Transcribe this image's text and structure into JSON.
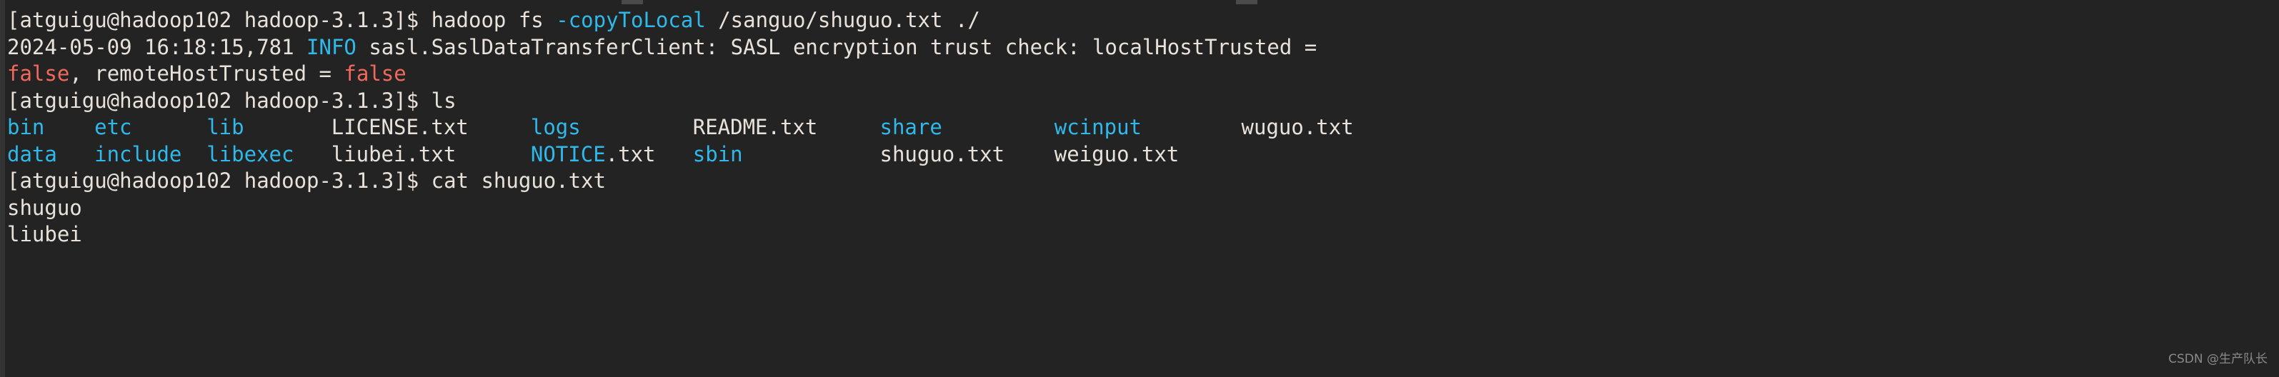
{
  "terminal": {
    "prompt": "[atguigu@hadoop102 hadoop-3.1.3]$ ",
    "colors": {
      "background": "#232323",
      "foreground": "#e9e2da",
      "cyan": "#2fb9ea",
      "red": "#f2695c",
      "gutter": "#1a1a1a"
    },
    "lines": [
      {
        "type": "command",
        "prompt": "[atguigu@hadoop102 hadoop-3.1.3]$ ",
        "command_pre": "hadoop fs ",
        "command_flag": "-copyToLocal",
        "command_post": " /sanguo/shuguo.txt ./"
      },
      {
        "type": "log",
        "timestamp": "2024-05-09 16:18:15,781 ",
        "level": "INFO",
        "message": " sasl.SaslDataTransferClient: SASL encryption trust check: localHostTrusted ="
      },
      {
        "type": "log-continued",
        "value1": "false",
        "middle": ", remoteHostTrusted = ",
        "value2": "false"
      },
      {
        "type": "command",
        "prompt": "[atguigu@hadoop102 hadoop-3.1.3]$ ",
        "command_pre": "ls",
        "command_flag": "",
        "command_post": ""
      },
      {
        "type": "ls-output"
      },
      {
        "type": "command",
        "prompt": "[atguigu@hadoop102 hadoop-3.1.3]$ ",
        "command_pre": "cat shuguo.txt",
        "command_flag": "",
        "command_post": ""
      },
      {
        "type": "output",
        "text": "shuguo"
      },
      {
        "type": "output",
        "text": "liubei"
      }
    ],
    "ls_output": {
      "row1": [
        {
          "name": "bin",
          "kind": "dir",
          "col": 0
        },
        {
          "name": "etc",
          "kind": "dir",
          "col": 7
        },
        {
          "name": "lib",
          "kind": "dir",
          "col": 16
        },
        {
          "name": "LICENSE.txt",
          "kind": "file",
          "col": 26
        },
        {
          "name": "logs",
          "kind": "dir",
          "col": 42
        },
        {
          "name": "README.txt",
          "kind": "file",
          "col": 55
        },
        {
          "name": "share",
          "kind": "dir",
          "col": 70
        },
        {
          "name": "wcinput",
          "kind": "dir",
          "col": 84
        },
        {
          "name": "wuguo.txt",
          "kind": "file",
          "col": 99
        }
      ],
      "row2": [
        {
          "name": "data",
          "kind": "dir",
          "col": 0
        },
        {
          "name": "include",
          "kind": "dir",
          "col": 7
        },
        {
          "name": "libexec",
          "kind": "dir",
          "col": 16
        },
        {
          "name": "liubei.txt",
          "kind": "file",
          "col": 26
        },
        {
          "name": "NOTICE",
          "kind": "dir",
          "col": 42,
          "suffix": ".txt"
        },
        {
          "name": "sbin",
          "kind": "dir",
          "col": 55
        },
        {
          "name": "shuguo.txt",
          "kind": "file",
          "col": 70
        },
        {
          "name": "weiguo.txt",
          "kind": "file",
          "col": 84
        }
      ]
    }
  },
  "watermark": {
    "text": "CSDN @生产队长"
  }
}
